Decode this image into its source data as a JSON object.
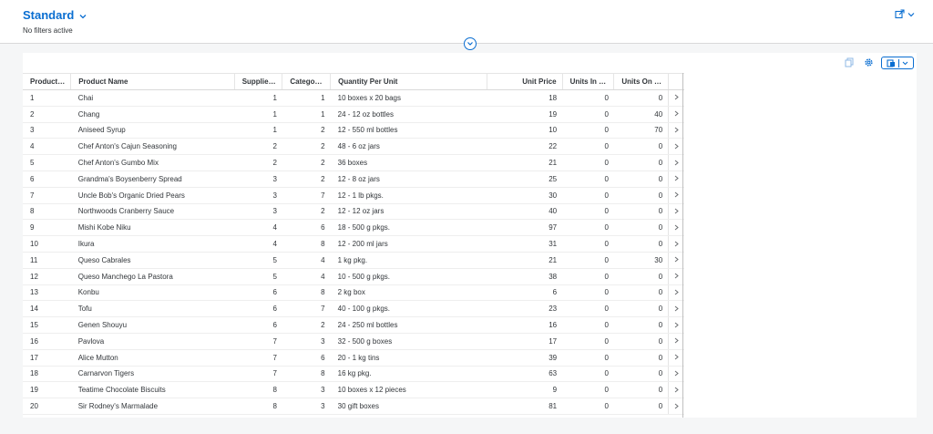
{
  "header": {
    "variant_title": "Standard",
    "filters_status": "No filters active"
  },
  "colors": {
    "accent": "#0a6ed1",
    "text": "#32363a",
    "background": "#f5f6f7"
  },
  "icons": {
    "variant_dropdown": "chevron-down-icon",
    "share": "share-icon",
    "collapse": "chevron-down-icon",
    "copy": "copy-icon",
    "settings": "gear-icon",
    "export": "export-spreadsheet-icon",
    "row_nav": "chevron-right-icon"
  },
  "table": {
    "columns": [
      "Product ID",
      "Product Name",
      "Supplier ID",
      "Category ID",
      "Quantity Per Unit",
      "Unit Price",
      "Units In Stock",
      "Units On Or..."
    ],
    "rows": [
      [
        "1",
        "Chai",
        "1",
        "1",
        "10 boxes x 20 bags",
        "18",
        "0",
        "0"
      ],
      [
        "2",
        "Chang",
        "1",
        "1",
        "24 - 12 oz bottles",
        "19",
        "0",
        "40"
      ],
      [
        "3",
        "Aniseed Syrup",
        "1",
        "2",
        "12 - 550 ml bottles",
        "10",
        "0",
        "70"
      ],
      [
        "4",
        "Chef Anton's Cajun Seasoning",
        "2",
        "2",
        "48 - 6 oz jars",
        "22",
        "0",
        "0"
      ],
      [
        "5",
        "Chef Anton's Gumbo Mix",
        "2",
        "2",
        "36 boxes",
        "21",
        "0",
        "0"
      ],
      [
        "6",
        "Grandma's Boysenberry Spread",
        "3",
        "2",
        "12 - 8 oz jars",
        "25",
        "0",
        "0"
      ],
      [
        "7",
        "Uncle Bob's Organic Dried Pears",
        "3",
        "7",
        "12 - 1 lb pkgs.",
        "30",
        "0",
        "0"
      ],
      [
        "8",
        "Northwoods Cranberry Sauce",
        "3",
        "2",
        "12 - 12 oz jars",
        "40",
        "0",
        "0"
      ],
      [
        "9",
        "Mishi Kobe Niku",
        "4",
        "6",
        "18 - 500 g pkgs.",
        "97",
        "0",
        "0"
      ],
      [
        "10",
        "Ikura",
        "4",
        "8",
        "12 - 200 ml jars",
        "31",
        "0",
        "0"
      ],
      [
        "11",
        "Queso Cabrales",
        "5",
        "4",
        "1 kg pkg.",
        "21",
        "0",
        "30"
      ],
      [
        "12",
        "Queso Manchego La Pastora",
        "5",
        "4",
        "10 - 500 g pkgs.",
        "38",
        "0",
        "0"
      ],
      [
        "13",
        "Konbu",
        "6",
        "8",
        "2 kg box",
        "6",
        "0",
        "0"
      ],
      [
        "14",
        "Tofu",
        "6",
        "7",
        "40 - 100 g pkgs.",
        "23",
        "0",
        "0"
      ],
      [
        "15",
        "Genen Shouyu",
        "6",
        "2",
        "24 - 250 ml bottles",
        "16",
        "0",
        "0"
      ],
      [
        "16",
        "Pavlova",
        "7",
        "3",
        "32 - 500 g boxes",
        "17",
        "0",
        "0"
      ],
      [
        "17",
        "Alice Mutton",
        "7",
        "6",
        "20 - 1 kg tins",
        "39",
        "0",
        "0"
      ],
      [
        "18",
        "Carnarvon Tigers",
        "7",
        "8",
        "16 kg pkg.",
        "63",
        "0",
        "0"
      ],
      [
        "19",
        "Teatime Chocolate Biscuits",
        "8",
        "3",
        "10 boxes x 12 pieces",
        "9",
        "0",
        "0"
      ],
      [
        "20",
        "Sir Rodney's Marmalade",
        "8",
        "3",
        "30 gift boxes",
        "81",
        "0",
        "0"
      ]
    ]
  }
}
